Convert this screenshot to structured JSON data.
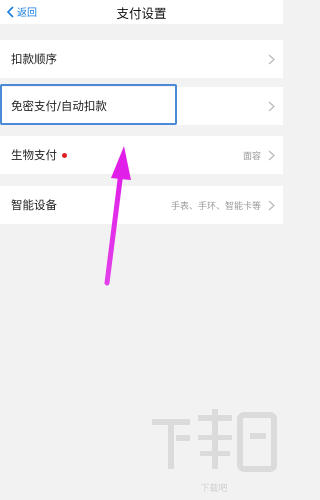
{
  "header": {
    "back_label": "返回",
    "title": "支付设置"
  },
  "settings": [
    {
      "label": "扣款顺序",
      "value": ""
    },
    {
      "label": "免密支付/自动扣款",
      "value": ""
    },
    {
      "label": "生物支付",
      "value": "面容"
    },
    {
      "label": "智能设备",
      "value": "手表、手环、智能卡等"
    }
  ],
  "watermark": {
    "text": "下载吧"
  },
  "colors": {
    "accent": "#1a7ee0",
    "highlight_border": "#4a8ad6",
    "annotation_arrow": "#e020e8",
    "badge_dot": "#e02020",
    "background": "#f2f2f2"
  }
}
